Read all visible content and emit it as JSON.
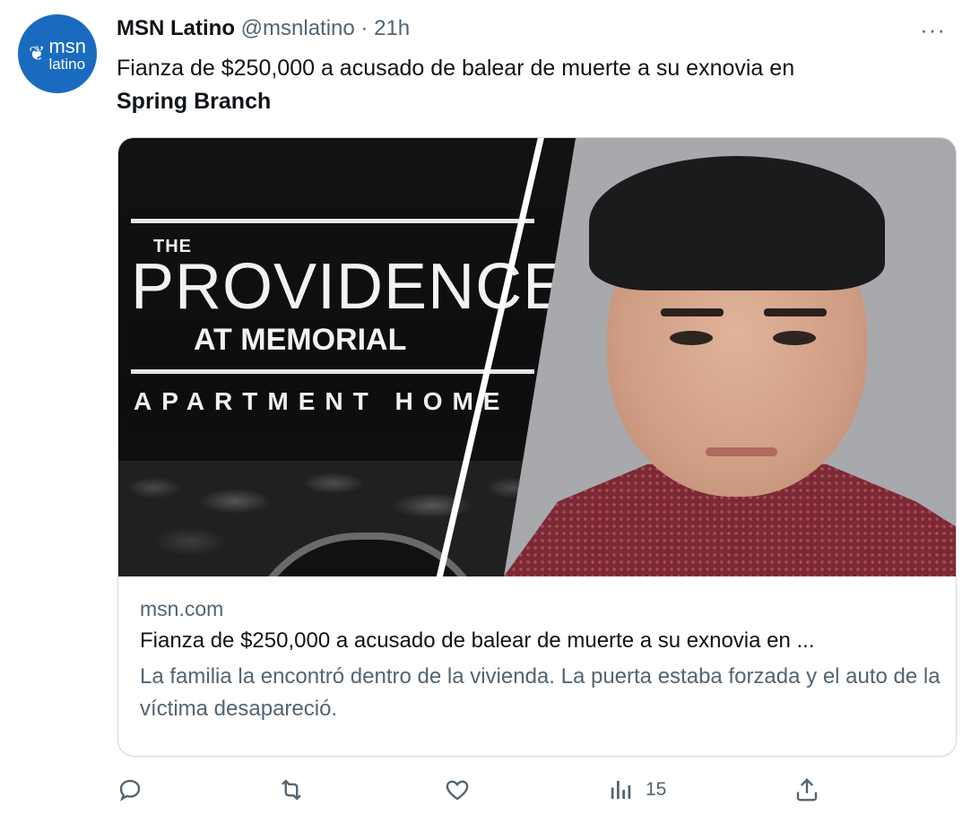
{
  "tweet": {
    "author_name": "MSN Latino",
    "handle": "@msnlatino",
    "separator": "·",
    "time": "21h",
    "text_main": "Fianza de $250,000 a acusado de balear de muerte a su exnovia en ",
    "text_bold": "Spring Branch",
    "avatar": {
      "line1": "msn",
      "line2": "latino",
      "icon": "butterfly-icon",
      "bg_color": "#1a6bc0"
    },
    "more_label": "···"
  },
  "card": {
    "image_sign": {
      "the": "THE",
      "providence": "PROVIDENCE",
      "at_memorial": "AT MEMORIAL",
      "apartment_home": "APARTMENT HOME"
    },
    "domain": "msn.com",
    "title": "Fianza de $250,000 a acusado de balear de muerte a su exnovia en ...",
    "description": "La familia la encontró dentro de la vivienda. La puerta estaba forzada y el auto de la víctima desapareció."
  },
  "actions": {
    "reply": {
      "icon": "reply-icon"
    },
    "retweet": {
      "icon": "retweet-icon"
    },
    "like": {
      "icon": "heart-icon"
    },
    "views": {
      "icon": "views-icon",
      "count": "15"
    },
    "share": {
      "icon": "share-icon"
    }
  },
  "colors": {
    "text": "#0f1419",
    "secondary": "#536471",
    "border": "#cfd9de"
  }
}
